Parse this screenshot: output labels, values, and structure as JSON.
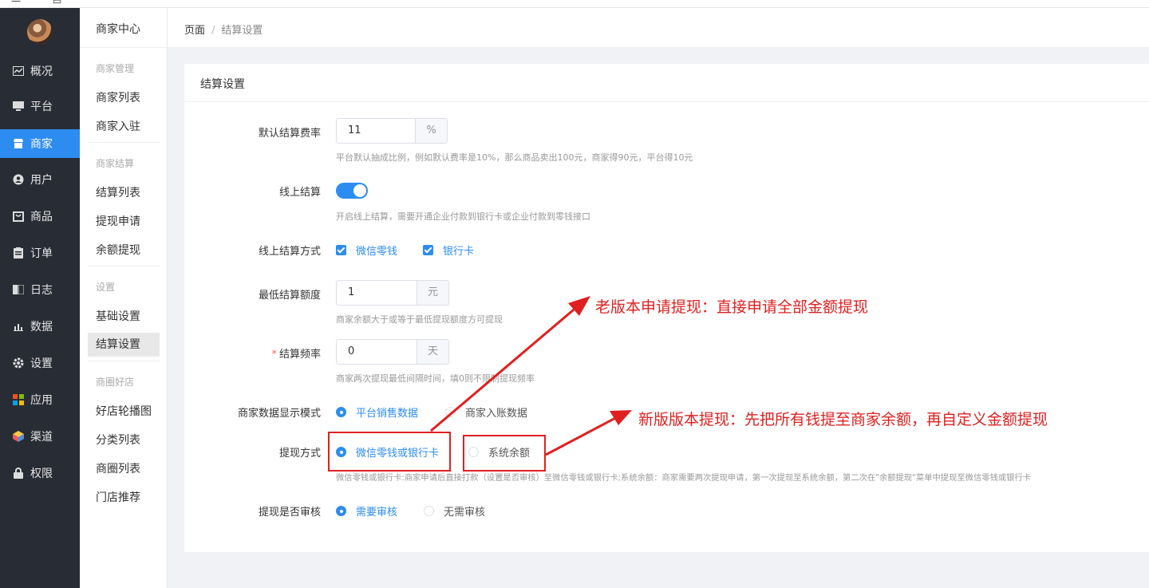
{
  "nav": {
    "items": [
      {
        "icon": "overview-icon",
        "label": "概况"
      },
      {
        "icon": "platform-icon",
        "label": "平台"
      },
      {
        "icon": "store-icon",
        "label": "商家"
      },
      {
        "icon": "user-icon",
        "label": "用户"
      },
      {
        "icon": "goods-icon",
        "label": "商品"
      },
      {
        "icon": "order-icon",
        "label": "订单"
      },
      {
        "icon": "log-icon",
        "label": "日志"
      },
      {
        "icon": "data-icon",
        "label": "数据"
      },
      {
        "icon": "gear-icon",
        "label": "设置"
      },
      {
        "icon": "apps-icon",
        "label": "应用"
      },
      {
        "icon": "channel-icon",
        "label": "渠道"
      },
      {
        "icon": "lock-icon",
        "label": "权限"
      }
    ],
    "active_index": 2
  },
  "side": {
    "header": "商家中心",
    "groups": {
      "merchant_mgmt": "商家管理",
      "merchant_settle": "商家结算",
      "settings": "设置",
      "circle": "商圈好店"
    },
    "links": {
      "merchant_list": "商家列表",
      "merchant_join": "商家入驻",
      "settle_list": "结算列表",
      "withdraw_apply": "提现申请",
      "balance_withdraw": "余额提现",
      "basic_settings": "基础设置",
      "settle_settings": "结算设置",
      "shop_carousel": "好店轮播图",
      "category_list": "分类列表",
      "circle_list": "商圈列表",
      "store_recommend": "门店推荐"
    }
  },
  "breadcrumb": {
    "root": "页面",
    "sep": "/",
    "current": "结算设置"
  },
  "card": {
    "title": "结算设置"
  },
  "form": {
    "rate": {
      "label": "默认结算费率",
      "value": "11",
      "suffix": "%",
      "hint": "平台默认抽成比例，例如默认费率是10%，那么商品卖出100元，商家得90元，平台得10元"
    },
    "online": {
      "label": "线上结算",
      "enabled": true,
      "hint": "开启线上结算，需要开通企业付款到银行卡或企业付款到零钱接口"
    },
    "online_method": {
      "label": "线上结算方式",
      "opt1": "微信零钱",
      "opt2": "银行卡"
    },
    "min_amount": {
      "label": "最低结算额度",
      "value": "1",
      "suffix": "元",
      "hint": "商家余额大于或等于最低提现额度方可提现"
    },
    "frequency": {
      "required": "*",
      "label": "结算频率",
      "value": "0",
      "suffix": "天",
      "hint": "商家两次提现最低间隔时间，填0则不限制提现频率"
    },
    "display_mode": {
      "label": "商家数据显示模式",
      "opt1": "平台销售数据",
      "opt2": "商家入账数据"
    },
    "withdraw_method": {
      "label": "提现方式",
      "opt1": "微信零钱或银行卡",
      "opt2": "系统余额",
      "hint": "微信零钱或银行卡:商家申请后直接打款（设置是否审核）至微信零钱或银行卡;系统余额：商家需要两次提现申请，第一次提现至系统余额，第二次在\"余额提现\"菜单中提现至微信零钱或银行卡"
    },
    "audit": {
      "label": "提现是否审核",
      "opt1": "需要审核",
      "opt2": "无需审核"
    }
  },
  "annotations": {
    "old": "老版本申请提现：直接申请全部金额提现",
    "new": "新版版本提现：先把所有钱提至商家余额，再自定义金额提现",
    "color": "#e02020"
  },
  "colors": {
    "accent": "#2d8cf0",
    "nav_bg": "#282c34"
  }
}
